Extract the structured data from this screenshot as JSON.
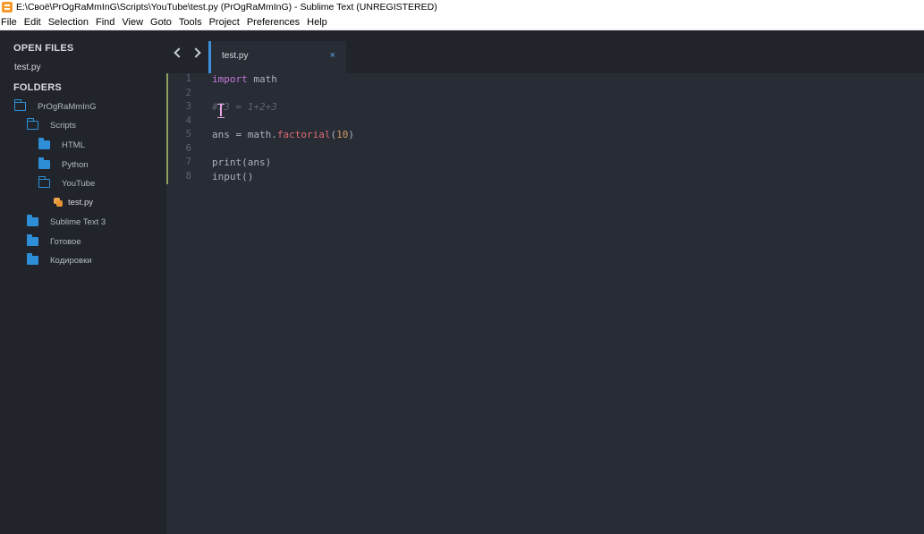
{
  "window": {
    "title": "E:\\Своё\\PrOgRaMmInG\\Scripts\\YouTube\\test.py (PrOgRaMmInG) - Sublime Text (UNREGISTERED)"
  },
  "menu": [
    "File",
    "Edit",
    "Selection",
    "Find",
    "View",
    "Goto",
    "Tools",
    "Project",
    "Preferences",
    "Help"
  ],
  "sidebar": {
    "open_files_heading": "OPEN FILES",
    "open_files": [
      "test.py"
    ],
    "folders_heading": "FOLDERS",
    "tree": [
      {
        "label": "PrOgRaMmInG",
        "icon": "folder-open-icon"
      },
      {
        "label": "Scripts",
        "icon": "folder-open-icon"
      },
      {
        "label": "HTML",
        "icon": "folder-icon"
      },
      {
        "label": "Python",
        "icon": "folder-icon"
      },
      {
        "label": "YouTube",
        "icon": "folder-open-icon"
      },
      {
        "label": "test.py",
        "icon": "python-file-icon"
      },
      {
        "label": "Sublime Text 3",
        "icon": "folder-icon"
      },
      {
        "label": "Готовое",
        "icon": "folder-icon"
      },
      {
        "label": "Кодировки",
        "icon": "folder-icon"
      }
    ]
  },
  "tabs": {
    "active_label": "test.py",
    "close_glyph": "×"
  },
  "editor": {
    "line_numbers": [
      "1",
      "2",
      "3",
      "4",
      "5",
      "6",
      "7",
      "8"
    ],
    "lines": {
      "l1_kw": "import",
      "l1_rest": " math",
      "l3_comment": "#73 = 1+2+3",
      "l5_a": "ans = math.",
      "l5_fn": "factorial",
      "l5_b": "(",
      "l5_num": "10",
      "l5_c": ")",
      "l7": "print(ans)",
      "l8": "input()"
    }
  },
  "colors": {
    "accent": "#3d8fdc",
    "folder": "#2e8fd8",
    "keyword": "#c678dd",
    "function": "#e06c75",
    "number": "#d19a66",
    "change_marker": "#8fa15f"
  }
}
